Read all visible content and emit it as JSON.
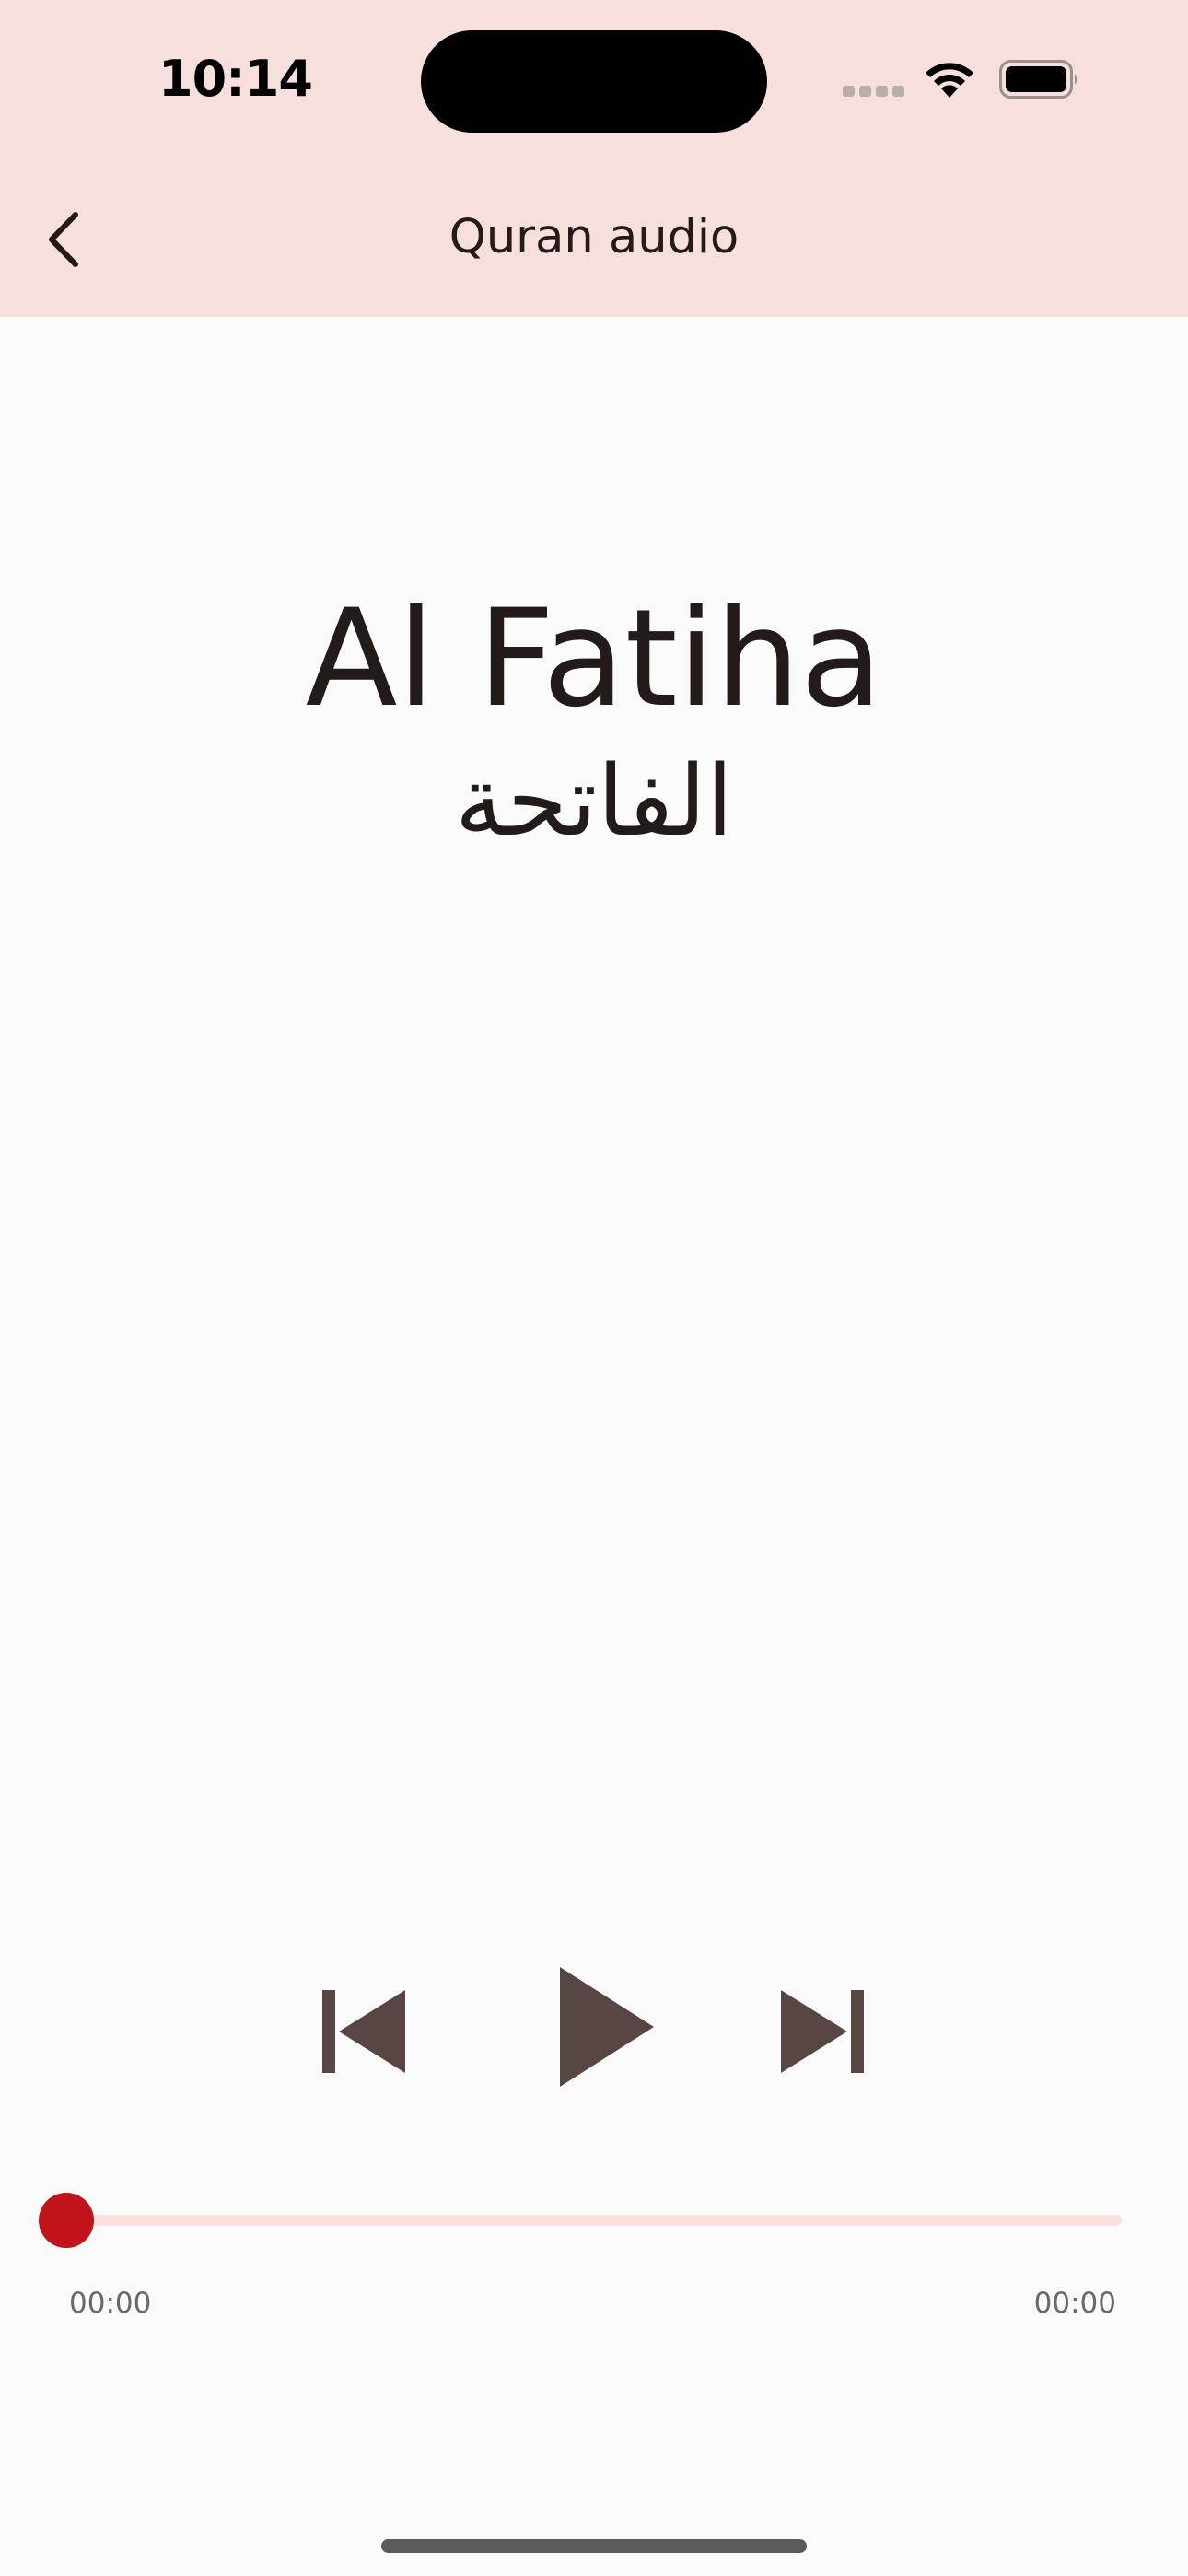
{
  "status_bar": {
    "time": "10:14",
    "icons": [
      "cellular-signal-icon",
      "wifi-icon",
      "battery-icon"
    ]
  },
  "app_bar": {
    "title": "Quran audio",
    "back_icon": "chevron-left-icon"
  },
  "surah": {
    "name_en": "Al Fatiha",
    "name_ar": "الفاتحة"
  },
  "player": {
    "controls": [
      "skip-previous-icon",
      "play-icon",
      "skip-next-icon"
    ],
    "progress": 0,
    "elapsed": "00:00",
    "duration": "00:00"
  },
  "colors": {
    "app_bar_bg": "#f6dfdc",
    "page_bg": "#fafafa",
    "control_color": "#574644",
    "accent": "#c0141a",
    "track": "#f8dfdc"
  }
}
